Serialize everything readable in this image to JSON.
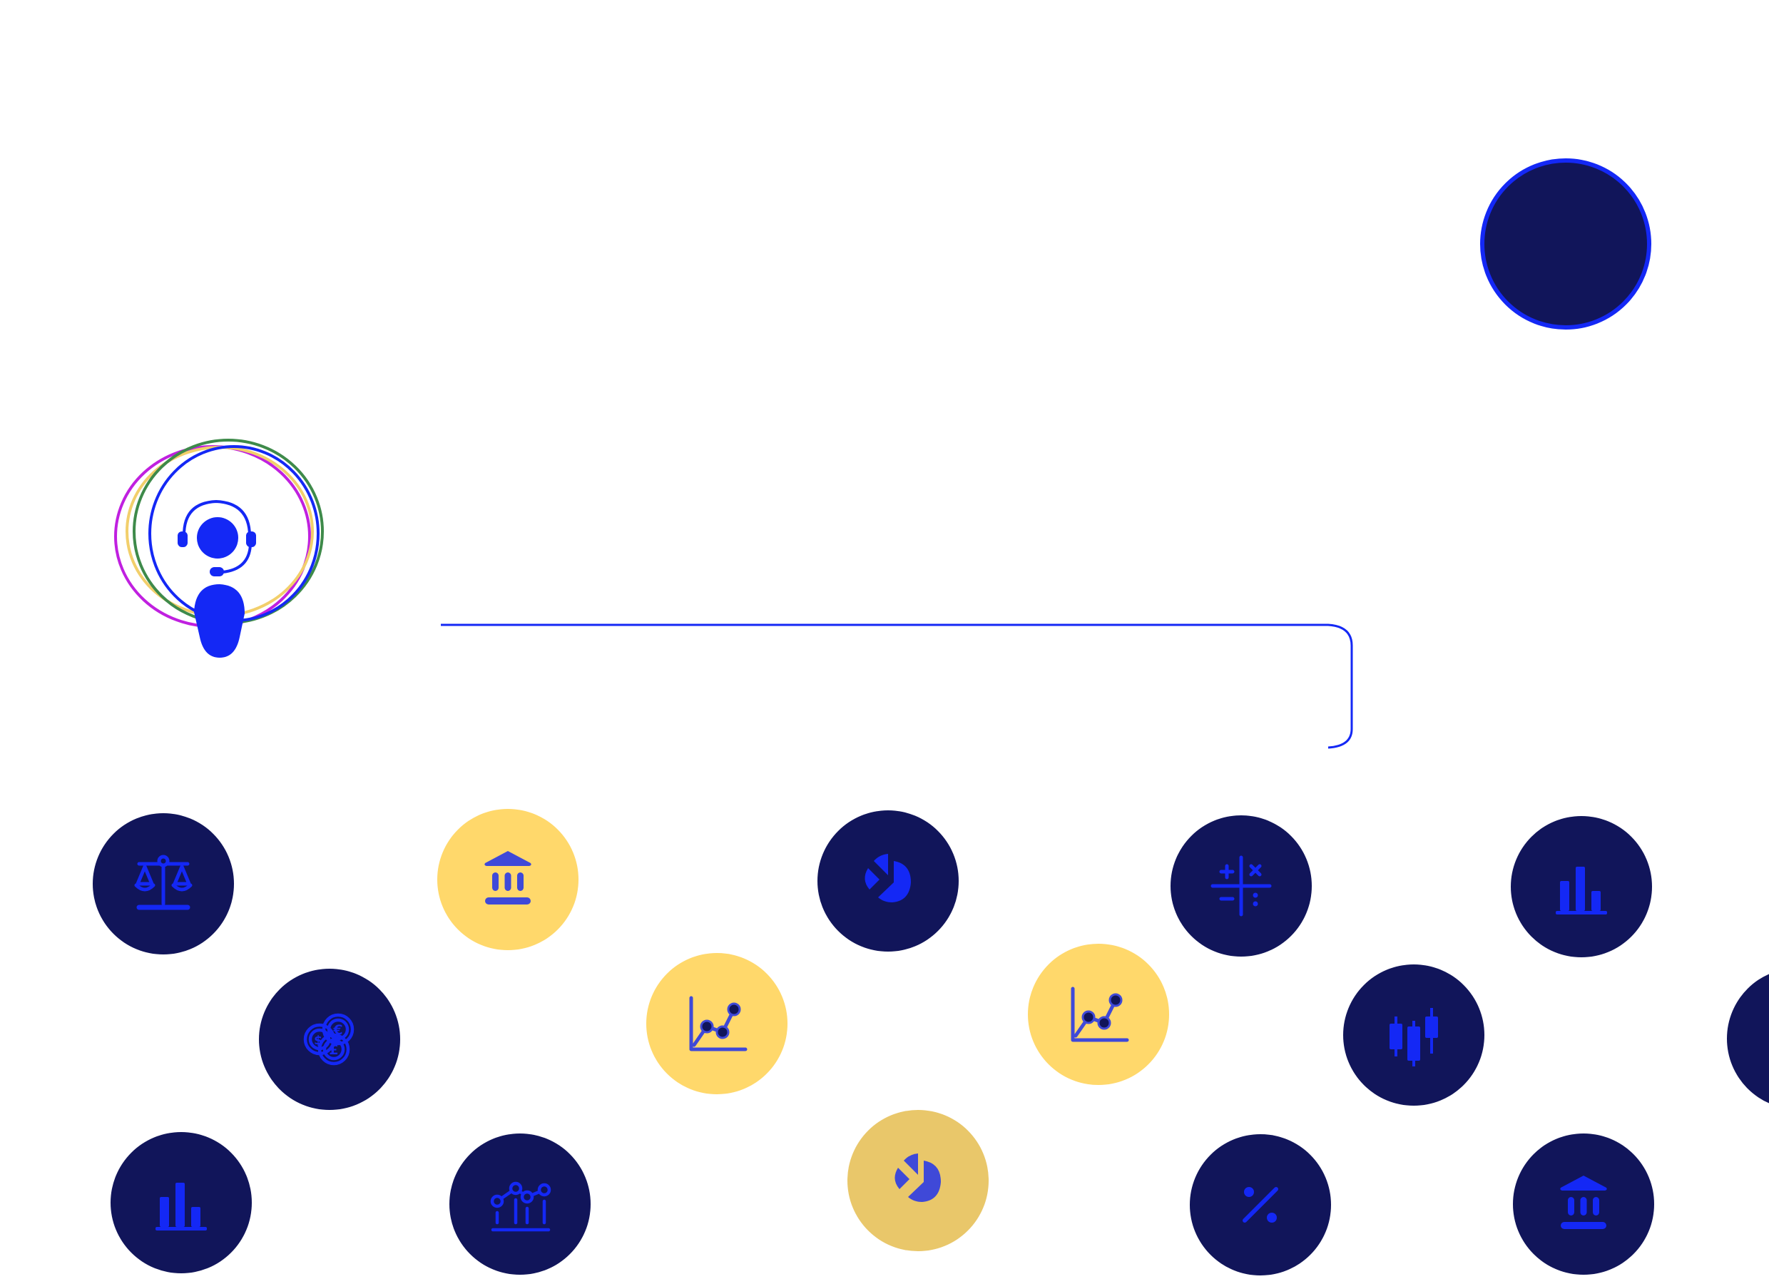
{
  "colors": {
    "navy": "#11155A",
    "blue": "#1428F5",
    "blue_soft": "#3F49D8",
    "yellow": "#FFD86B",
    "gold": "#E9C76A",
    "ring_magenta": "#C020E0",
    "ring_green": "#3E8A4A",
    "ring_yellow": "#F2CF6B",
    "ring_blue": "#1428F5"
  },
  "hero": {
    "icon": "customer-support-headset-icon"
  },
  "accent_circle": {
    "fill": "#11155A",
    "stroke": "#1428F5"
  },
  "tiles": [
    {
      "icon": "balance-scale-icon",
      "theme": "navy"
    },
    {
      "icon": "bank-building-icon",
      "theme": "yellow"
    },
    {
      "icon": "pie-chart-icon",
      "theme": "navy"
    },
    {
      "icon": "calculator-signs-icon",
      "theme": "navy"
    },
    {
      "icon": "bar-chart-icon",
      "theme": "navy"
    },
    {
      "icon": "currency-coins-icon",
      "theme": "navy"
    },
    {
      "icon": "line-chart-icon",
      "theme": "yellow"
    },
    {
      "icon": "line-chart-icon",
      "theme": "yellow"
    },
    {
      "icon": "candlestick-chart-icon",
      "theme": "navy"
    },
    {
      "icon": "currency-coins-icon",
      "theme": "navy"
    },
    {
      "icon": "bar-chart-icon",
      "theme": "navy"
    },
    {
      "icon": "trend-bar-chart-icon",
      "theme": "navy"
    },
    {
      "icon": "pie-chart-icon",
      "theme": "gold"
    },
    {
      "icon": "percent-icon",
      "theme": "navy"
    },
    {
      "icon": "bank-building-icon",
      "theme": "navy"
    }
  ]
}
